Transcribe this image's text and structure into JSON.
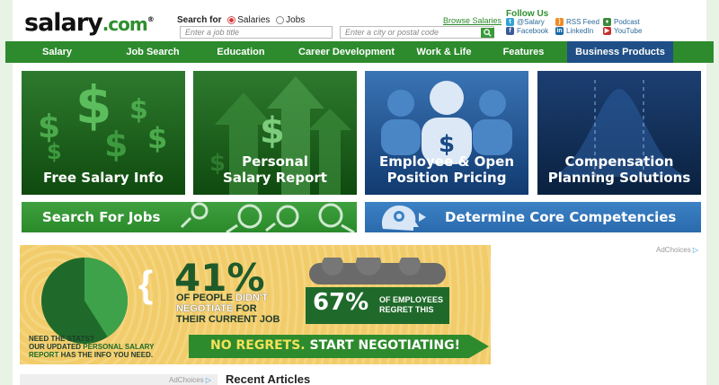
{
  "header": {
    "logo_main": "salary",
    "logo_com": ".com",
    "logo_reg": "®",
    "search_for_label": "Search for",
    "radio_salaries": "Salaries",
    "radio_jobs": "Jobs",
    "job_placeholder": "Enter a job title",
    "city_placeholder": "Enter a city or postal code",
    "browse_salaries": "Browse Salaries",
    "follow_us": "Follow Us",
    "social": {
      "twitter": "@Salary",
      "facebook": "Facebook",
      "rss": "RSS Feed",
      "linkedin": "LinkedIn",
      "podcast": "Podcast",
      "youtube": "YouTube"
    }
  },
  "nav": {
    "items": [
      "Salary",
      "Job Search",
      "Education",
      "Career Development",
      "Work & Life",
      "Features",
      "Business Products"
    ]
  },
  "tiles": {
    "free_salary": "Free Salary Info",
    "personal_report_1": "Personal",
    "personal_report_2": "Salary Report",
    "employee_1": "Employee & Open",
    "employee_2": "Position Pricing",
    "comp_1": "Compensation",
    "comp_2": "Planning Solutions"
  },
  "bars": {
    "search_jobs": "Search For Jobs",
    "competencies": "Determine Core Competencies"
  },
  "promo": {
    "pct_41": "41%",
    "line1_a": "OF PEOPLE ",
    "line1_b": "DIDN'T",
    "line2_a": "NEGOTIATE",
    "line2_b": " FOR",
    "line3": "THEIR CURRENT JOB",
    "pct_67": "67%",
    "regret_1": "OF EMPLOYEES",
    "regret_2": "REGRET THIS",
    "need_1": "NEED THE STATS?",
    "need_2a": "OUR UPDATED ",
    "need_2b": "PERSONAL SALARY",
    "need_3a": "REPORT",
    "need_3b": " HAS THE INFO YOU NEED.",
    "cta_a": "NO REGRETS. ",
    "cta_b": "START NEGOTIATING!",
    "pie_fraction": 0.41
  },
  "adchoices": "AdChoices",
  "recent_articles": "Recent Articles",
  "colors": {
    "nav_green": "#2d8b2d",
    "nav_business": "#1f4f86",
    "promo_yellow": "#f2cc6a",
    "accent_green": "#2f8f2f"
  }
}
